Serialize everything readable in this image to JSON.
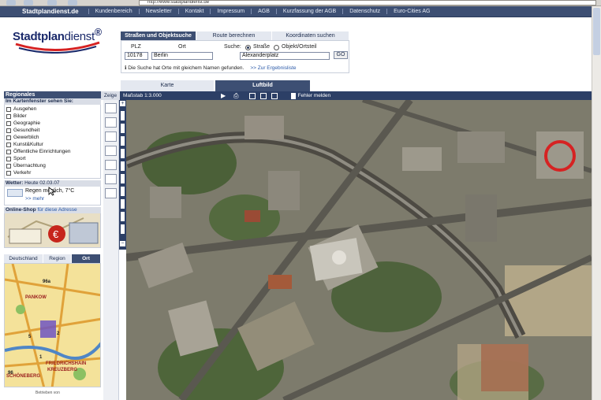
{
  "browser": {
    "address": "http://www.stadtplandienst.de"
  },
  "topnav": {
    "brand": "Stadtplandienst.de",
    "items": [
      "Kundenbereich",
      "Newsletter",
      "Kontakt",
      "Impressum",
      "AGB",
      "Kurzfassung der AGB",
      "Datenschutz",
      "Euro-Cities AG"
    ]
  },
  "logo": {
    "bold": "Stadtplan",
    "light": "dienst",
    "mark": "®"
  },
  "search": {
    "tabs": [
      "Straßen und Objektsuche",
      "Route berechnen",
      "Koordinaten suchen"
    ],
    "plz_label": "PLZ",
    "ort_label": "Ort",
    "suche_label": "Suche:",
    "radio_strasse": "Straße",
    "radio_objekt": "Objekt/Ortsteil",
    "plz_value": "10178",
    "ort_value": "Berlin",
    "strasse_value": "Alexanderplatz",
    "go": "GO",
    "hint": "Die Suche hat Orte mit gleichem Namen gefunden.",
    "hint_link": ">> Zur Ergebnisliste"
  },
  "maptabs": {
    "karte": "Karte",
    "luftbild": "Luftbild"
  },
  "toolbar": {
    "zeige": "Zeige",
    "massstab": "Maßstab 1:3.000",
    "fehler": "Fehler melden"
  },
  "sidebar": {
    "regionales": "Regionales",
    "im_kartenfenster": "Im Kartenfenster sehen Sie:",
    "categories": [
      "Ausgehen",
      "Bilder",
      "Geographie",
      "Gesundheit",
      "Gewerblich",
      "Kunst&Kultur",
      "Öffentliche Einrichtungen",
      "Sport",
      "Übernachtung",
      "Verkehr"
    ],
    "wetter_label": "Wetter:",
    "wetter_date": "Heute 02.03.07",
    "wetter_text": "Regen möglich, 7°C",
    "wetter_more": ">> mehr",
    "shop_label": "Online-Shop",
    "shop_suffix": "für diese Adresse",
    "region_tabs": [
      "Deutschland",
      "Region",
      "Ort"
    ],
    "minimap_labels": [
      "PANKOW",
      "FRIEDRICHSHAIN",
      "KREUZBERG",
      "SCHÖNEBERG"
    ],
    "minimap_numbers": [
      "96a",
      "96",
      "2",
      "1",
      "5"
    ],
    "powered": "Betrieben von"
  },
  "colors": {
    "nav": "#3d4f73",
    "accent_dark": "#2c3f66",
    "marker": "#d62222"
  }
}
